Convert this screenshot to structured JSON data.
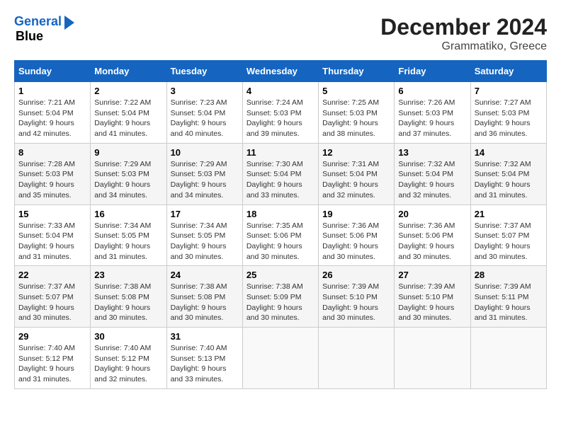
{
  "header": {
    "logo_line1": "General",
    "logo_line2": "Blue",
    "title": "December 2024",
    "subtitle": "Grammatiko, Greece"
  },
  "weekdays": [
    "Sunday",
    "Monday",
    "Tuesday",
    "Wednesday",
    "Thursday",
    "Friday",
    "Saturday"
  ],
  "weeks": [
    [
      {
        "day": "1",
        "sunrise": "Sunrise: 7:21 AM",
        "sunset": "Sunset: 5:04 PM",
        "daylight": "Daylight: 9 hours and 42 minutes."
      },
      {
        "day": "2",
        "sunrise": "Sunrise: 7:22 AM",
        "sunset": "Sunset: 5:04 PM",
        "daylight": "Daylight: 9 hours and 41 minutes."
      },
      {
        "day": "3",
        "sunrise": "Sunrise: 7:23 AM",
        "sunset": "Sunset: 5:04 PM",
        "daylight": "Daylight: 9 hours and 40 minutes."
      },
      {
        "day": "4",
        "sunrise": "Sunrise: 7:24 AM",
        "sunset": "Sunset: 5:03 PM",
        "daylight": "Daylight: 9 hours and 39 minutes."
      },
      {
        "day": "5",
        "sunrise": "Sunrise: 7:25 AM",
        "sunset": "Sunset: 5:03 PM",
        "daylight": "Daylight: 9 hours and 38 minutes."
      },
      {
        "day": "6",
        "sunrise": "Sunrise: 7:26 AM",
        "sunset": "Sunset: 5:03 PM",
        "daylight": "Daylight: 9 hours and 37 minutes."
      },
      {
        "day": "7",
        "sunrise": "Sunrise: 7:27 AM",
        "sunset": "Sunset: 5:03 PM",
        "daylight": "Daylight: 9 hours and 36 minutes."
      }
    ],
    [
      {
        "day": "8",
        "sunrise": "Sunrise: 7:28 AM",
        "sunset": "Sunset: 5:03 PM",
        "daylight": "Daylight: 9 hours and 35 minutes."
      },
      {
        "day": "9",
        "sunrise": "Sunrise: 7:29 AM",
        "sunset": "Sunset: 5:03 PM",
        "daylight": "Daylight: 9 hours and 34 minutes."
      },
      {
        "day": "10",
        "sunrise": "Sunrise: 7:29 AM",
        "sunset": "Sunset: 5:03 PM",
        "daylight": "Daylight: 9 hours and 34 minutes."
      },
      {
        "day": "11",
        "sunrise": "Sunrise: 7:30 AM",
        "sunset": "Sunset: 5:04 PM",
        "daylight": "Daylight: 9 hours and 33 minutes."
      },
      {
        "day": "12",
        "sunrise": "Sunrise: 7:31 AM",
        "sunset": "Sunset: 5:04 PM",
        "daylight": "Daylight: 9 hours and 32 minutes."
      },
      {
        "day": "13",
        "sunrise": "Sunrise: 7:32 AM",
        "sunset": "Sunset: 5:04 PM",
        "daylight": "Daylight: 9 hours and 32 minutes."
      },
      {
        "day": "14",
        "sunrise": "Sunrise: 7:32 AM",
        "sunset": "Sunset: 5:04 PM",
        "daylight": "Daylight: 9 hours and 31 minutes."
      }
    ],
    [
      {
        "day": "15",
        "sunrise": "Sunrise: 7:33 AM",
        "sunset": "Sunset: 5:04 PM",
        "daylight": "Daylight: 9 hours and 31 minutes."
      },
      {
        "day": "16",
        "sunrise": "Sunrise: 7:34 AM",
        "sunset": "Sunset: 5:05 PM",
        "daylight": "Daylight: 9 hours and 31 minutes."
      },
      {
        "day": "17",
        "sunrise": "Sunrise: 7:34 AM",
        "sunset": "Sunset: 5:05 PM",
        "daylight": "Daylight: 9 hours and 30 minutes."
      },
      {
        "day": "18",
        "sunrise": "Sunrise: 7:35 AM",
        "sunset": "Sunset: 5:06 PM",
        "daylight": "Daylight: 9 hours and 30 minutes."
      },
      {
        "day": "19",
        "sunrise": "Sunrise: 7:36 AM",
        "sunset": "Sunset: 5:06 PM",
        "daylight": "Daylight: 9 hours and 30 minutes."
      },
      {
        "day": "20",
        "sunrise": "Sunrise: 7:36 AM",
        "sunset": "Sunset: 5:06 PM",
        "daylight": "Daylight: 9 hours and 30 minutes."
      },
      {
        "day": "21",
        "sunrise": "Sunrise: 7:37 AM",
        "sunset": "Sunset: 5:07 PM",
        "daylight": "Daylight: 9 hours and 30 minutes."
      }
    ],
    [
      {
        "day": "22",
        "sunrise": "Sunrise: 7:37 AM",
        "sunset": "Sunset: 5:07 PM",
        "daylight": "Daylight: 9 hours and 30 minutes."
      },
      {
        "day": "23",
        "sunrise": "Sunrise: 7:38 AM",
        "sunset": "Sunset: 5:08 PM",
        "daylight": "Daylight: 9 hours and 30 minutes."
      },
      {
        "day": "24",
        "sunrise": "Sunrise: 7:38 AM",
        "sunset": "Sunset: 5:08 PM",
        "daylight": "Daylight: 9 hours and 30 minutes."
      },
      {
        "day": "25",
        "sunrise": "Sunrise: 7:38 AM",
        "sunset": "Sunset: 5:09 PM",
        "daylight": "Daylight: 9 hours and 30 minutes."
      },
      {
        "day": "26",
        "sunrise": "Sunrise: 7:39 AM",
        "sunset": "Sunset: 5:10 PM",
        "daylight": "Daylight: 9 hours and 30 minutes."
      },
      {
        "day": "27",
        "sunrise": "Sunrise: 7:39 AM",
        "sunset": "Sunset: 5:10 PM",
        "daylight": "Daylight: 9 hours and 30 minutes."
      },
      {
        "day": "28",
        "sunrise": "Sunrise: 7:39 AM",
        "sunset": "Sunset: 5:11 PM",
        "daylight": "Daylight: 9 hours and 31 minutes."
      }
    ],
    [
      {
        "day": "29",
        "sunrise": "Sunrise: 7:40 AM",
        "sunset": "Sunset: 5:12 PM",
        "daylight": "Daylight: 9 hours and 31 minutes."
      },
      {
        "day": "30",
        "sunrise": "Sunrise: 7:40 AM",
        "sunset": "Sunset: 5:12 PM",
        "daylight": "Daylight: 9 hours and 32 minutes."
      },
      {
        "day": "31",
        "sunrise": "Sunrise: 7:40 AM",
        "sunset": "Sunset: 5:13 PM",
        "daylight": "Daylight: 9 hours and 33 minutes."
      },
      null,
      null,
      null,
      null
    ]
  ]
}
